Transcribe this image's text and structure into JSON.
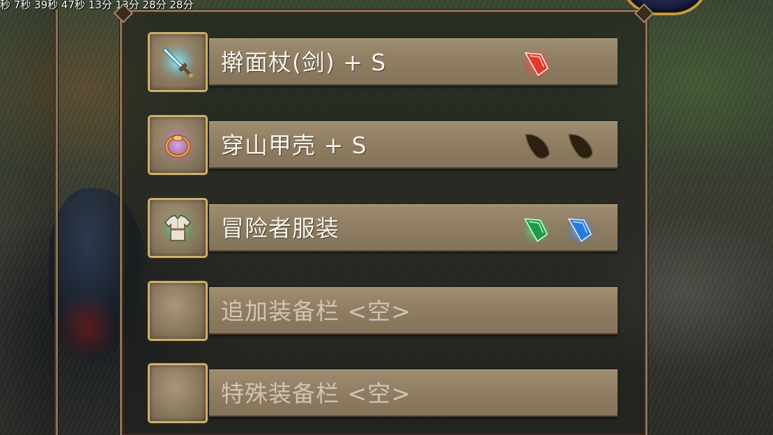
{
  "hud": {
    "status_text": "秒 7秒 39秒 47秒 13分 13分 28分 28分"
  },
  "equipment": {
    "slots": [
      {
        "name": "擀面杖(剑) + S",
        "icon": "sword-icon",
        "empty": false,
        "gems": [
          "red-gem-icon"
        ]
      },
      {
        "name": "穿山甲壳 + S",
        "icon": "ring-icon",
        "empty": false,
        "gems": [
          "dark-scale-icon",
          "dark-scale-icon"
        ]
      },
      {
        "name": "冒险者服装",
        "icon": "tunic-icon",
        "empty": false,
        "gems": [
          "green-gem-icon",
          "blue-gem-icon"
        ]
      },
      {
        "name": "追加装备栏 <空>",
        "icon": "",
        "empty": true,
        "gems": []
      },
      {
        "name": "特殊装备栏 <空>",
        "icon": "",
        "empty": true,
        "gems": []
      }
    ]
  },
  "colors": {
    "frame_border": "#8b7458",
    "icon_border": "#d0b06e",
    "bar_fill": "#8e7d62",
    "text": "#f7f4ec",
    "empty_text": "#cfc5b3"
  }
}
